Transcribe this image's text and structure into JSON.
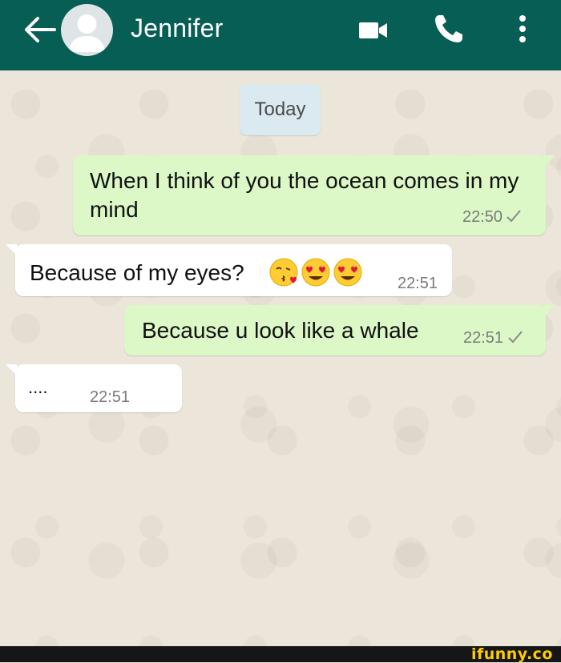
{
  "header": {
    "contact_name": "Jennifer",
    "icons": [
      "back-arrow-icon",
      "avatar-placeholder",
      "video-call-icon",
      "voice-call-icon",
      "more-options-icon"
    ],
    "background_color": "#075e54"
  },
  "chat": {
    "date_separator": "Today",
    "messages": [
      {
        "direction": "outgoing",
        "text": "When I think of you the ocean comes in my mind",
        "time": "22:50",
        "status": "sent-check"
      },
      {
        "direction": "incoming",
        "text": "Because of my eyes?",
        "emojis": [
          "kissing-face-with-heart-emoji",
          "heart-eyes-emoji",
          "heart-eyes-emoji"
        ],
        "time": "22:51"
      },
      {
        "direction": "outgoing",
        "text": "Because u look like a whale",
        "time": "22:51",
        "status": "sent-check"
      },
      {
        "direction": "incoming",
        "text": "....",
        "time": "22:51"
      }
    ],
    "outgoing_bubble_color": "#dcf8c6",
    "incoming_bubble_color": "#ffffff"
  },
  "watermark": {
    "text": "ifunny.co"
  }
}
